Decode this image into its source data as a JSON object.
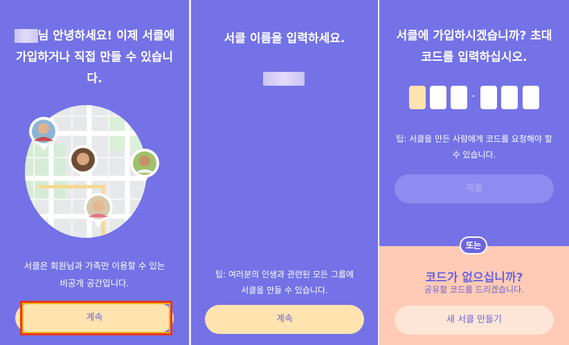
{
  "panel1": {
    "heading_line1": "님 안녕하세요! 이제 서클에",
    "heading_line2": "가입하거나 직접 만들 수 있습니",
    "heading_line3": "다.",
    "body_line1": "서클은 회원님과 가족만 이용할 수 있는",
    "body_line2": "비공개 공간입니다.",
    "continue_label": "계속"
  },
  "panel2": {
    "heading": "서클 이름을 입력하세요.",
    "tip_line1": "팁: 여러분의 인생과 관련된 모든 그룹에",
    "tip_line2": "서클을 만들 수 있습니다.",
    "continue_label": "계속"
  },
  "panel3": {
    "heading_line1": "서클에 가입하시겠습니까? 초대",
    "heading_line2": "코드를 입력하십시오.",
    "tip_line1": "팁: 서클을 만든 사람에게 코드를 요청해야 할",
    "tip_line2": "수 있습니다.",
    "submit_label": "제출",
    "or_label": "또는",
    "no_code_title": "코드가 없으십니까?",
    "no_code_sub": "공유할 코드를 드리겠습니다.",
    "create_label": "새 서클 만들기"
  },
  "colors": {
    "background": "#7472e6",
    "primary_button": "#ffe4b0",
    "card_bg": "#ffcbb6",
    "focus_ring": "#e8371b"
  }
}
